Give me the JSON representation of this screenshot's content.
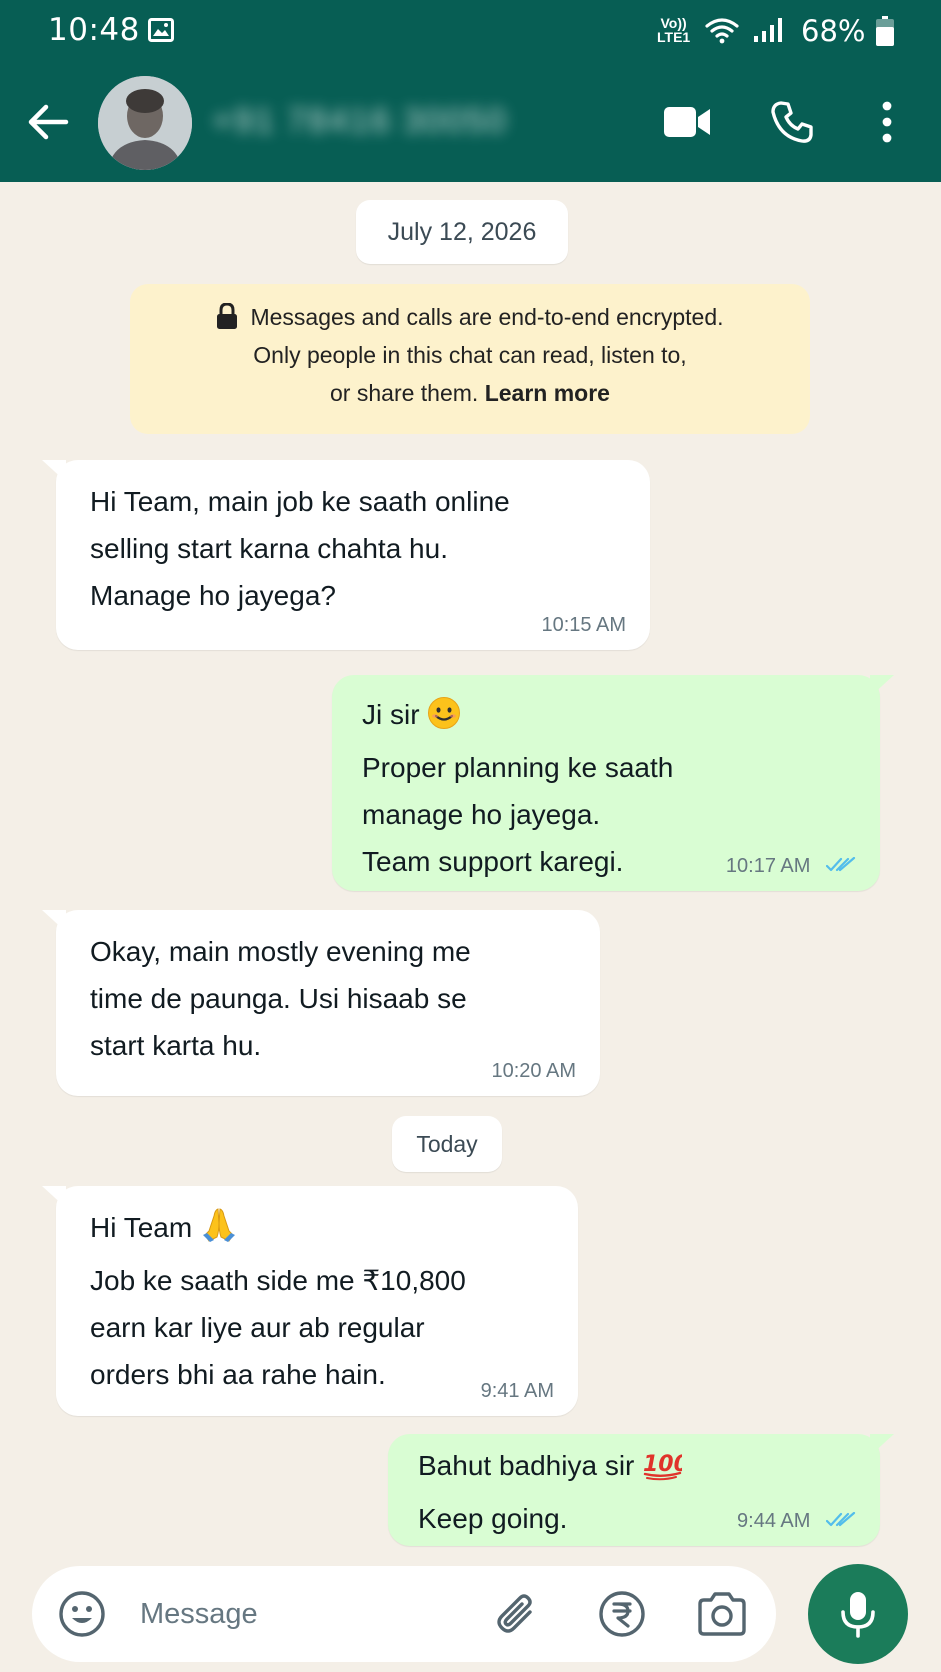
{
  "status_bar": {
    "time": "10:48",
    "volte_top": "Vo))",
    "volte_bottom": "LTE1",
    "battery": "68%"
  },
  "header": {
    "contact_name": "+91 78416 30050",
    "icons": [
      "back-arrow-icon",
      "video-call-icon",
      "phone-icon",
      "more-vertical-icon"
    ]
  },
  "chat": {
    "date_1": "July 12, 2026",
    "encryption": {
      "line_1": "Messages and calls are end-to-end encrypted.",
      "line_2": "Only people in this chat can read, listen to,",
      "line_3": "or share them.",
      "link": "Learn more"
    },
    "messages": [
      {
        "direction": "incoming",
        "text": "Hi Team, main job ke saath online\nselling start karna chahta hu.\nManage ho jayega?",
        "time": "10:15 AM"
      },
      {
        "direction": "outgoing",
        "first_line": "Ji sir",
        "emoji": "😊",
        "text": "Proper planning ke saath\nmanage ho jayega.\nTeam support karegi.",
        "time": "10:17 AM",
        "read": true
      },
      {
        "direction": "incoming",
        "text": "Okay, main mostly evening me\ntime de paunga. Usi hisaab se\nstart karta hu.",
        "time": "10:20 AM"
      },
      {
        "direction": "incoming",
        "first_line": "Hi Team",
        "emoji": "🙏",
        "text": "Job ke saath side me ₹10,800\nearn kar liye aur ab regular\norders bhi aa rahe hain.",
        "time": "9:41 AM"
      },
      {
        "direction": "outgoing",
        "first_line": "Bahut badhiya sir",
        "emoji": "💯",
        "text": "Keep going.",
        "time": "9:44 AM",
        "read": true
      }
    ],
    "date_2": "Today"
  },
  "composer": {
    "placeholder": "Message"
  },
  "colors": {
    "header": "#075e54",
    "background": "#f4efe7",
    "outgoing_bubble": "#d9fdd3",
    "incoming_bubble": "#ffffff",
    "read_ticks": "#53bdeb",
    "mic_button": "#1b7c5a",
    "encryption_notice": "#fdf2cc"
  }
}
